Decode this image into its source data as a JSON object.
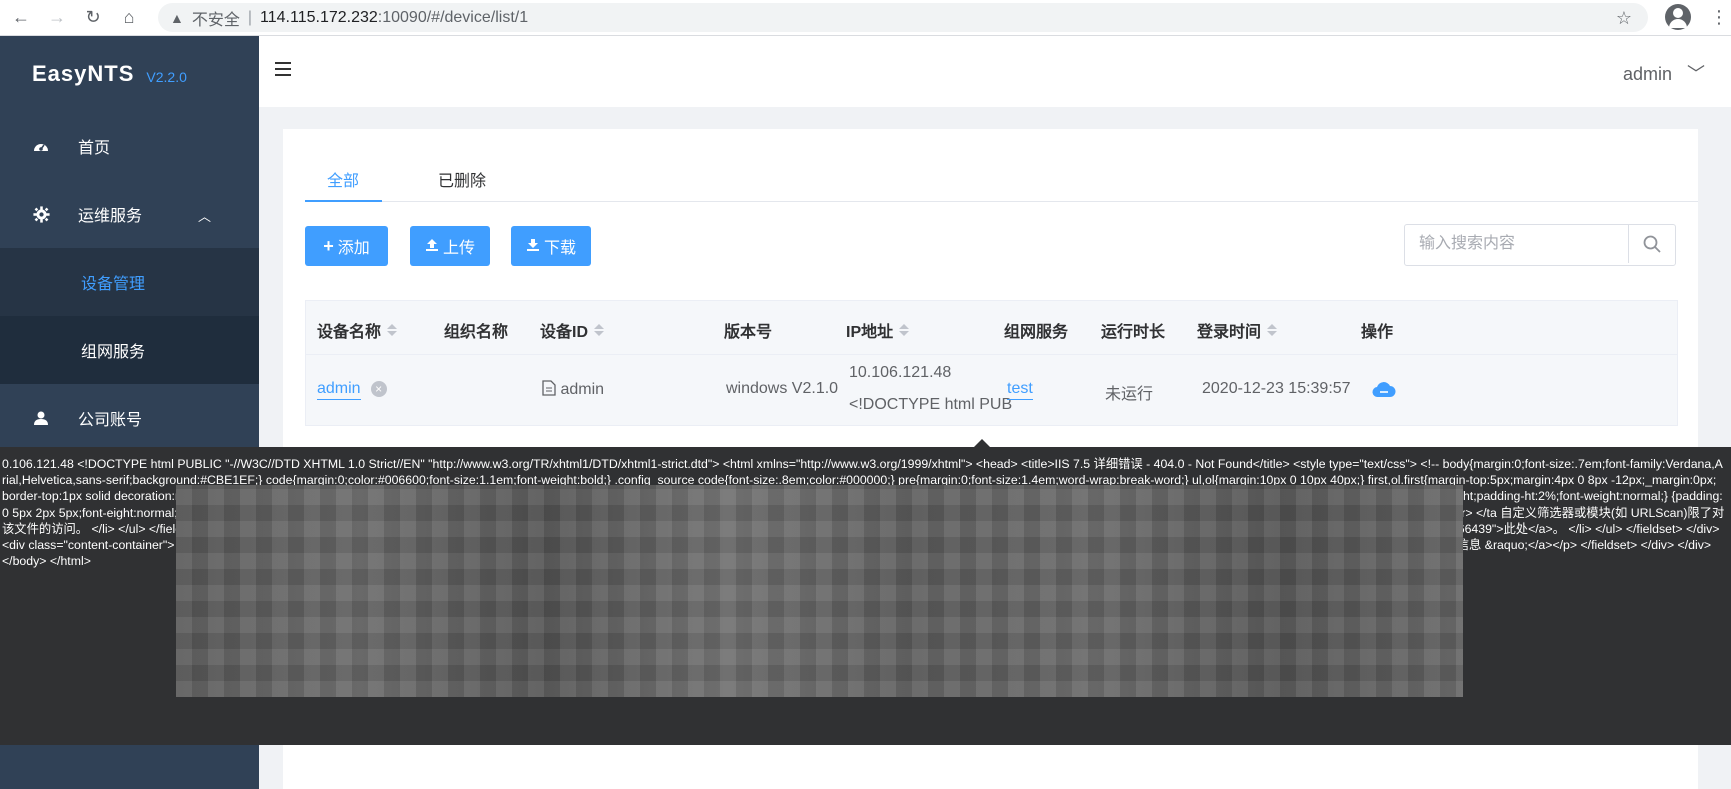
{
  "browser": {
    "insecure_label": "不安全",
    "url_host": "114.115.172.232",
    "url_rest": ":10090/#/device/list/1"
  },
  "app": {
    "name": "EasyNTS",
    "version": "V2.2.0"
  },
  "sidebar": {
    "items": [
      {
        "label": "首页",
        "icon": "dashboard-icon"
      },
      {
        "label": "运维服务",
        "icon": "gear-icon",
        "expanded": true
      },
      {
        "label": "设备管理",
        "active": true
      },
      {
        "label": "组网服务"
      },
      {
        "label": "公司账号",
        "icon": "user-icon"
      }
    ]
  },
  "header": {
    "user": "admin"
  },
  "tabs": [
    {
      "label": "全部",
      "active": true
    },
    {
      "label": "已删除"
    }
  ],
  "toolbar": {
    "add_label": "添加",
    "upload_label": "上传",
    "download_label": "下载"
  },
  "search": {
    "placeholder": "输入搜索内容"
  },
  "table": {
    "headers": [
      "设备名称",
      "组织名称",
      "设备ID",
      "版本号",
      "IP地址",
      "组网服务",
      "运行时长",
      "登录时间",
      "操作"
    ],
    "rows": [
      {
        "name": "admin",
        "org": "",
        "device_id": "admin",
        "version": "windows V2.1.0",
        "ip_line1": "10.106.121.48",
        "ip_line2": "<!DOCTYPE html PUB",
        "service": "test",
        "runtime": "未运行",
        "login_time": "2020-12-23 15:39:57"
      }
    ]
  },
  "tooltip": {
    "text": "0.106.121.48 <!DOCTYPE html PUBLIC \"-//W3C//DTD XHTML 1.0 Strict//EN\" \"http://www.w3.org/TR/xhtml1/DTD/xhtml1-strict.dtd\"> <html xmlns=\"http://www.w3.org/1999/xhtml\"> <head> <title>IIS 7.5 详细错误 - 404.0 - Not Found</title> <style type=\"text/css\"> <!-- body{margin:0;font-size:.7em;font-family:Verdana,Arial,Helvetica,sans-serif;background:#CBE1EF;} code{margin:0;color:#006600;font-size:1.1em;font-weight:bold;} .config_source code{font-size:.8em;color:#000000;} pre{margin:0;font-size:1.4em;word-wrap:break-word;} ul,ol{margin:10px 0 10px 40px;} first,ol.first{margin-top:5px;margin:4px 0 8px -12px;_margin:0px; border-top:1px solid decoration:none;} h1{font-size:2.4em;margin:0;color:#F chet MS\",Verdana,sans-serif; lor:#FFF;background-color p{margin:0 0 10px 0; }#details-t{width:35%;float:left;margin solid #C1CFDD;border-top:1px lid #4A6C8E;font-weight:no 0%;text-align:right;padding-ht:2%;font-weight:normal;} {padding:0 5px 2px 5px;font-eight:normal;background:#0 id=\"content\"> <div ass=\"content-container\"> <f egend> <div id=\"details-left\"> <table order=\"0\" cellpadding=\"0\" 2</td></tr> </table> </div> <div \"details-right\"> <table bo 匿名</td></tr> <tr><th>登录用户 h><td>匿名</td></tr> </ta 自定义筛选器或模块(如 URLScan)限了对该文件的访问。 </li> </ul> </fieldset> </div> <div class=\"content-container\"> <fieldset><legend>可尝试的操作:</legend> 失败请求, 并查看是哪个模块在调用 etStatus。有关为失败的请求创建跟踪规则的详细信息，请单击<a href=\"http://go.microsoft.com/fwlink/?LinkID=66439\">此处</a>。 </li> </ul> </fieldset> </div> <div class=\"content-container\"> <fieldset><legend>链接和更多信息</legend> 此错误表明文件或目录在服务器上不存在。请创建件或目录并重新尝试请求。 <p><a href=\"http://go.microsoft.com/fwlink/?LinkID=62293&amp;IIS70Error=404,0,0x80070002,7601\">查看更多信息 &raquo;</a></p> </fieldset> </div> </div> </body> </html>"
  },
  "colors": {
    "primary": "#409eff",
    "sidebar_bg": "#304156",
    "submenu_bg": "#1f2d3d",
    "tooltip_bg": "#303133"
  }
}
